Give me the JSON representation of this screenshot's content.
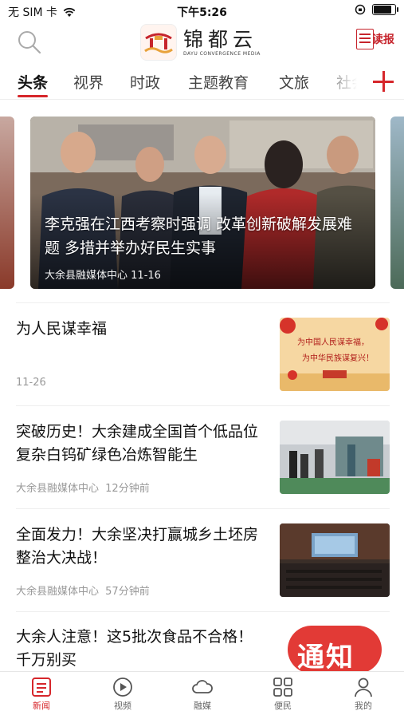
{
  "status_bar": {
    "carrier": "无 SIM 卡",
    "time": "下午5:26",
    "battery_level": 0.9
  },
  "header": {
    "app_name": "锦都云",
    "app_subtitle": "DAYU CONVERGENCE MEDIA",
    "read_label": "读报",
    "icons": [
      "search-icon",
      "newspaper-icon"
    ]
  },
  "tabs": [
    {
      "label": "头条",
      "active": true
    },
    {
      "label": "视界",
      "active": false
    },
    {
      "label": "时政",
      "active": false
    },
    {
      "label": "主题教育",
      "active": false
    },
    {
      "label": "文旅",
      "active": false
    },
    {
      "label": "社会",
      "active": false
    }
  ],
  "carousel": {
    "title": "李克强在江西考察时强调 改革创新破解发展难题 多措并举办好民生实事",
    "source": "大余县融媒体中心",
    "date": "11-16"
  },
  "news": [
    {
      "title": "为人民谋幸福",
      "source": "",
      "time": "11-26"
    },
    {
      "title": "突破历史！大余建成全国首个低品位复杂白钨矿绿色冶炼智能生",
      "source": "大余县融媒体中心",
      "time": "12分钟前"
    },
    {
      "title": "全面发力！大余坚决打赢城乡土坯房整治大决战！",
      "source": "大余县融媒体中心",
      "time": "57分钟前"
    },
    {
      "title": "大余人注意！这5批次食品不合格！千万别买",
      "source": "",
      "time": "",
      "thumb_text": "通知"
    }
  ],
  "banner_thumb": {
    "line1": "为中国人民谋幸福，",
    "line2": "为中华民族谋复兴！"
  },
  "bottom_nav": [
    {
      "label": "新闻",
      "icon": "news-icon",
      "active": true
    },
    {
      "label": "视频",
      "icon": "video-icon",
      "active": false
    },
    {
      "label": "融媒",
      "icon": "cloud-icon",
      "active": false
    },
    {
      "label": "便民",
      "icon": "grid-icon",
      "active": false
    },
    {
      "label": "我的",
      "icon": "profile-icon",
      "active": false
    }
  ],
  "colors": {
    "accent": "#d6262b",
    "text": "#111111",
    "meta": "#999999"
  }
}
